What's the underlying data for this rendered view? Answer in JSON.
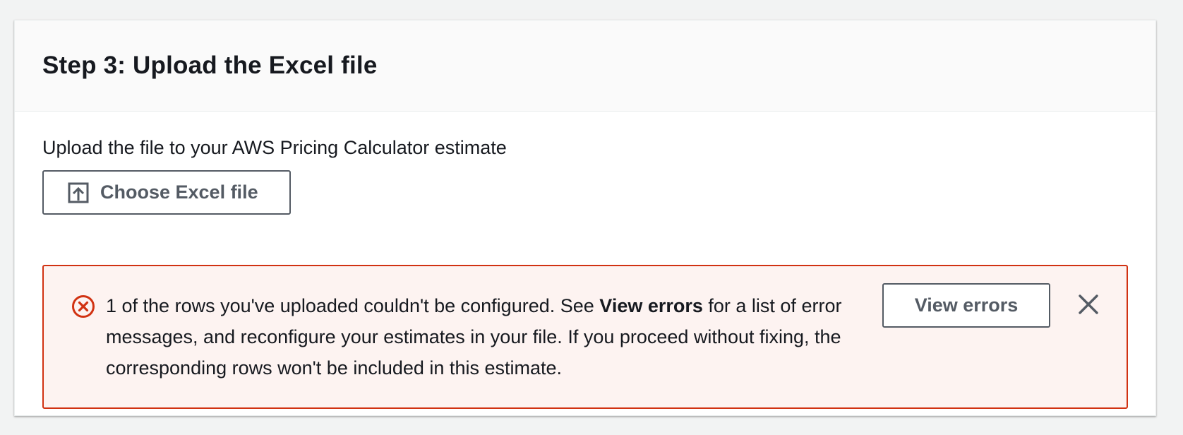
{
  "panel": {
    "title": "Step 3: Upload the Excel file",
    "description": "Upload the file to your AWS Pricing Calculator estimate",
    "choose_button": {
      "label": "Choose Excel file",
      "icon": "upload-icon"
    }
  },
  "alert": {
    "type": "error",
    "icon": "error-circle-icon",
    "message_prefix": "1 of the rows you've uploaded couldn't be configured. See ",
    "message_bold": "View errors",
    "message_suffix": " for a list of error messages, and reconfigure your estimates in your file. If you proceed without fixing, the corresponding rows won't be included in this estimate.",
    "action_label": "View errors",
    "dismiss_icon": "close-icon",
    "colors": {
      "border": "#d13212",
      "background": "#fdf3f1",
      "icon": "#d13212"
    }
  }
}
